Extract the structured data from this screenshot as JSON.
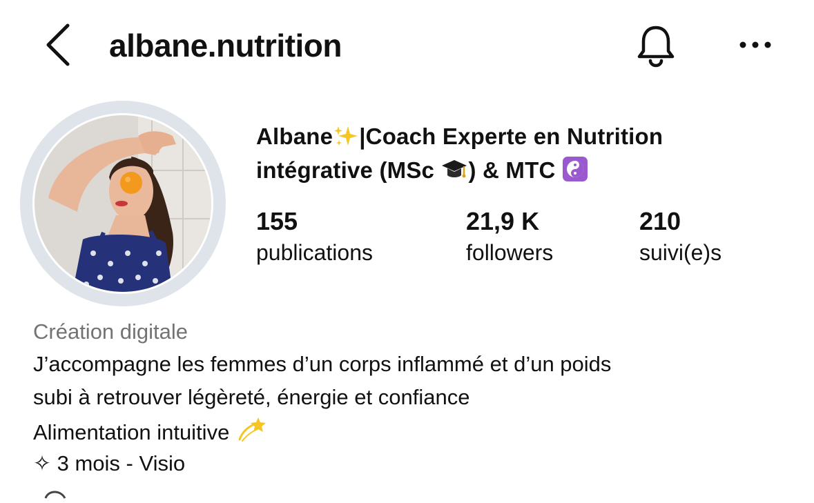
{
  "header": {
    "username": "albane.nutrition",
    "back_icon": "chevron-left-icon",
    "notification_icon": "bell-icon",
    "more_icon": "more-horizontal-icon"
  },
  "profile": {
    "display_name_part1": "Albane",
    "display_name_part2": "|Coach Experte en Nutrition",
    "display_name_part3": "intégrative (MSc ",
    "display_name_part4": ") & MTC ",
    "emojis": [
      "sparkles",
      "graduation-cap",
      "yin-yang"
    ],
    "stats": {
      "posts": {
        "count": "155",
        "label": "publications"
      },
      "followers": {
        "count": "21,9 K",
        "label": "followers"
      },
      "following": {
        "count": "210",
        "label": "suivi(e)s"
      }
    },
    "category": "Création digitale",
    "bio": {
      "line1": "J’accompagne les femmes d’un corps inflammé et d’un poids",
      "line2": "subi à retrouver légèreté, énergie et confiance",
      "line3": "Alimentation intuitive",
      "line4_icon": "✧",
      "line4": "3 mois - Visio"
    }
  },
  "colors": {
    "text": "#111111",
    "muted": "#737373",
    "avatar_ring": "#dfe3ea",
    "yin_yang_bg": "#9b59d0",
    "sparkle": "#f5c623"
  }
}
